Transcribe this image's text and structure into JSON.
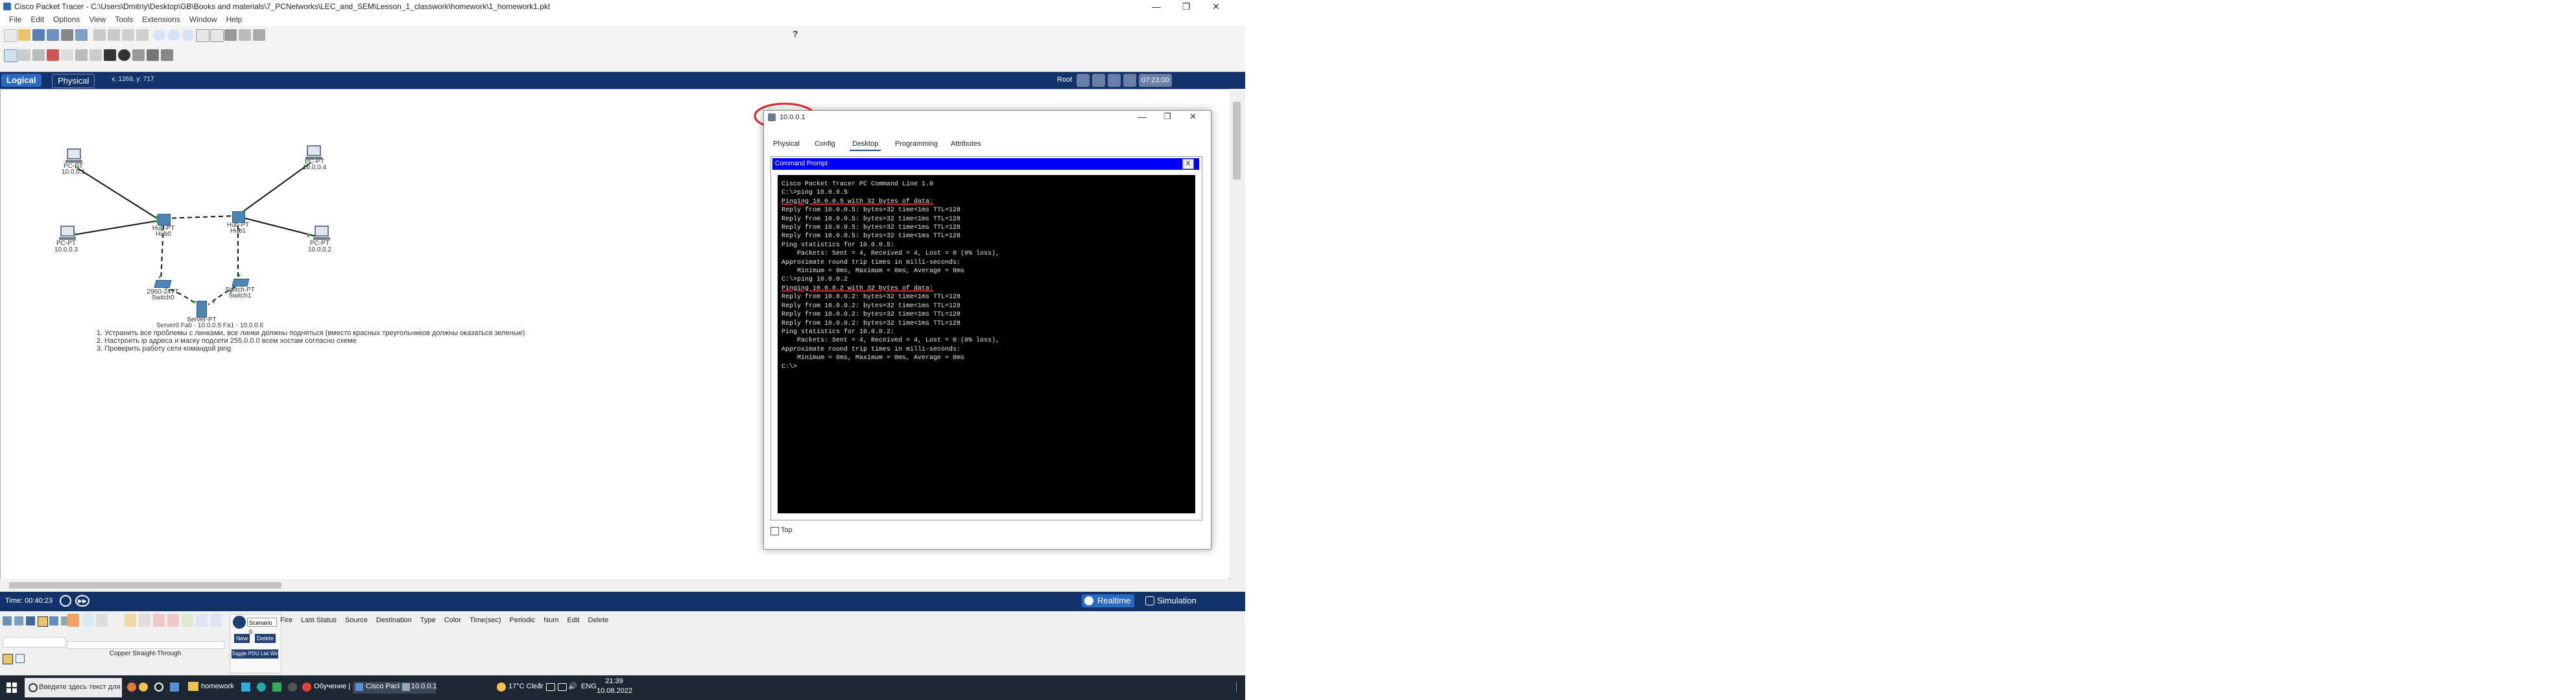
{
  "window": {
    "title": "Cisco Packet Tracer - C:\\Users\\Dmitriy\\Desktop\\GB\\Books and materials\\7_PCNetworks\\LEC_and_SEM\\Lesson_1_classwork\\homework\\1_homework1.pkt",
    "controls": [
      "—",
      "❐",
      "✕"
    ]
  },
  "menu": [
    "File",
    "Edit",
    "Options",
    "View",
    "Tools",
    "Extensions",
    "Window",
    "Help"
  ],
  "help_icon": "?",
  "modebar": {
    "logical": "Logical",
    "physical": "Physical",
    "coords": "x: 1269, y: 717",
    "root": "Root",
    "clock": "07:23:00"
  },
  "network": {
    "devices": [
      {
        "type": "PC-PT",
        "name": "10.0.0.1"
      },
      {
        "type": "PC-PT",
        "name": "10.0.0.4"
      },
      {
        "type": "PC-PT",
        "name": "10.0.0.3"
      },
      {
        "type": "PC-PT",
        "name": "10.0.0.2"
      },
      {
        "type": "Hub-PT",
        "name": "Hub0"
      },
      {
        "type": "Hub-PT",
        "name": "Hub1"
      },
      {
        "type": "2960-24TT",
        "name": "Switch0"
      },
      {
        "type": "Switch-PT",
        "name": "Switch1"
      },
      {
        "type": "Server-PT",
        "name": "Server0 Fa0 - 10.0.0.5 Fa1 - 10.0.0.6"
      }
    ],
    "notes": [
      "1. Устранить все проблемы с линками, все линки должны подняться (вместо красных треугольников должны оказаться зеленые)",
      "2. Настроить ip адреса и маску подсети 255.0.0.0 всем хостам согласно схеме",
      "3. Проверить работу сети командой ping"
    ]
  },
  "pc_window": {
    "title": "10.0.0.1",
    "tabs": [
      "Physical",
      "Config",
      "Desktop",
      "Programming",
      "Attributes"
    ],
    "active_tab": "Desktop",
    "cmd_title": "Command Prompt",
    "cmd_close": "X",
    "top_checkbox_label": "Top",
    "terminal_lines": [
      "",
      "Cisco Packet Tracer PC Command Line 1.0",
      "C:\\>ping 10.0.0.5",
      "",
      "Pinging 10.0.0.5 with 32 bytes of data:",
      "",
      "Reply from 10.0.0.5: bytes=32 time<1ms TTL=128",
      "Reply from 10.0.0.5: bytes=32 time<1ms TTL=128",
      "Reply from 10.0.0.5: bytes=32 time<1ms TTL=128",
      "Reply from 10.0.0.5: bytes=32 time<1ms TTL=128",
      "",
      "Ping statistics for 10.0.0.5:",
      "    Packets: Sent = 4, Received = 4, Lost = 0 (0% loss),",
      "Approximate round trip times in milli-seconds:",
      "    Minimum = 0ms, Maximum = 0ms, Average = 0ms",
      "",
      "C:\\>ping 10.0.0.2",
      "",
      "Pinging 10.0.0.2 with 32 bytes of data:",
      "",
      "Reply from 10.0.0.2: bytes=32 time<1ms TTL=128",
      "Reply from 10.0.0.2: bytes=32 time<1ms TTL=128",
      "Reply from 10.0.0.2: bytes=32 time<1ms TTL=128",
      "Reply from 10.0.0.2: bytes=32 time<1ms TTL=128",
      "",
      "Ping statistics for 10.0.0.2:",
      "    Packets: Sent = 4, Received = 4, Lost = 0 (0% loss),",
      "Approximate round trip times in milli-seconds:",
      "    Minimum = 0ms, Maximum = 0ms, Average = 0ms",
      "",
      "C:\\>"
    ]
  },
  "timebar": {
    "time": "Time: 00:40:23",
    "realtime": "Realtime",
    "simulation": "Simulation"
  },
  "bottom": {
    "scenario": "Scenario 0",
    "new": "New",
    "delete": "Delete",
    "toggle_pdu": "Toggle PDU List Window",
    "columns": [
      "Fire",
      "Last Status",
      "Source",
      "Destination",
      "Type",
      "Color",
      "Time(sec)",
      "Periodic",
      "Num",
      "Edit",
      "Delete"
    ],
    "connection_label": "Copper Straight-Through"
  },
  "taskbar": {
    "search_placeholder": "Введите здесь текст для поиска",
    "apps": [
      "homework",
      "Обучение | GeekBr...",
      "Cisco Packet Tracer...",
      "10.0.0.1"
    ],
    "weather": "17°C  Clear",
    "lang": "ENG",
    "time": "21:39",
    "date": "10.08.2022"
  },
  "colors": {
    "modebar": "#12336b",
    "cmd_titlebar": "#0000ff",
    "annotation": "#e0232b",
    "link_up": "#2fb82f",
    "taskbar": "#1d2733"
  }
}
